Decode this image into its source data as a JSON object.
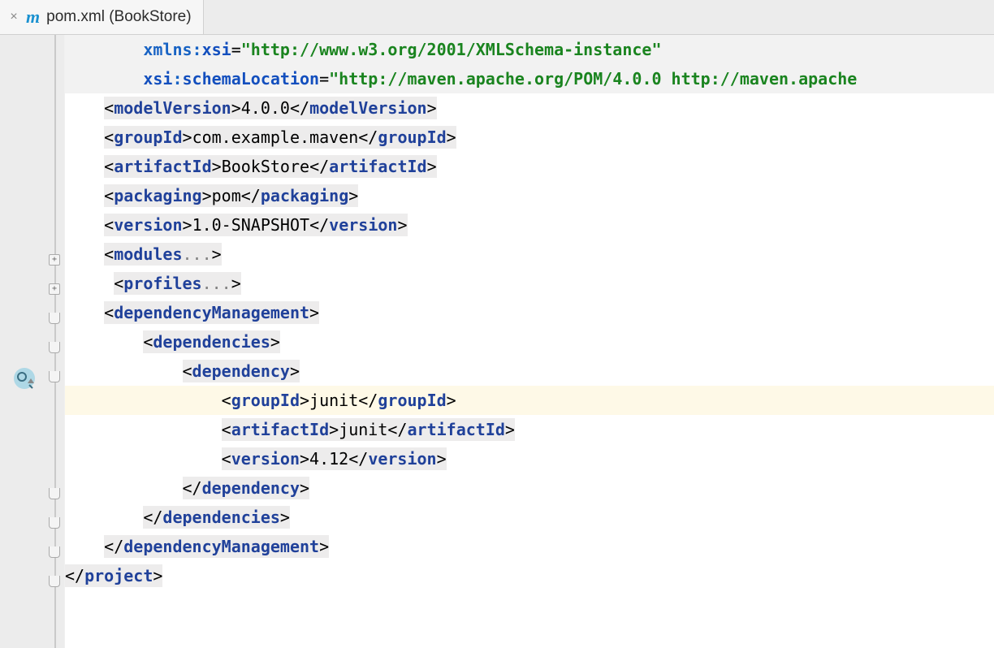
{
  "tab": {
    "close": "×",
    "icon": "m",
    "label": "pom.xml (BookStore)"
  },
  "code": {
    "l0": {
      "pre": "        ",
      "a1p": "xmlns:",
      "a1s": "xsi",
      "eq": "=",
      "v1": "\"http://www.w3.org/2001/XMLSchema-instance\""
    },
    "l1": {
      "pre": "        ",
      "a1p": "xsi",
      "colon": ":",
      "a1s": "schemaLocation",
      "eq": "=",
      "v1": "\"http://maven.apache.org/POM/4.0.0 http://maven.apache"
    },
    "l2": {
      "pre": "    ",
      "o": "<",
      "t": "modelVersion",
      "c": ">",
      "x": "4.0.0",
      "o2": "</",
      "t2": "modelVersion",
      "c2": ">"
    },
    "l3": {
      "pre": "    ",
      "o": "<",
      "t": "groupId",
      "c": ">",
      "x": "com.example.maven",
      "o2": "</",
      "t2": "groupId",
      "c2": ">"
    },
    "l4": {
      "pre": "    ",
      "o": "<",
      "t": "artifactId",
      "c": ">",
      "x": "BookStore",
      "o2": "</",
      "t2": "artifactId",
      "c2": ">"
    },
    "l5": {
      "pre": "    ",
      "o": "<",
      "t": "packaging",
      "c": ">",
      "x": "pom",
      "o2": "</",
      "t2": "packaging",
      "c2": ">"
    },
    "l6": {
      "pre": "    ",
      "o": "<",
      "t": "version",
      "c": ">",
      "x": "1.0-SNAPSHOT",
      "o2": "</",
      "t2": "version",
      "c2": ">"
    },
    "l7": {
      "pre": "    ",
      "o": "<",
      "t": "modules",
      "e": "...",
      "c": ">"
    },
    "l8": {
      "pre": "     ",
      "o": "<",
      "t": "profiles",
      "e": "...",
      "c": ">"
    },
    "l9": {
      "pre": "    ",
      "o": "<",
      "t": "dependencyManagement",
      "c": ">"
    },
    "l10": {
      "pre": "        ",
      "o": "<",
      "t": "dependencies",
      "c": ">"
    },
    "l11": {
      "pre": "            ",
      "o": "<",
      "t": "dependency",
      "c": ">"
    },
    "l12": {
      "pre": "                ",
      "o": "<",
      "t": "groupId",
      "c": ">",
      "x": "junit",
      "o2": "</",
      "t2": "groupId",
      "c2": ">"
    },
    "l13": {
      "pre": "                ",
      "o": "<",
      "t": "artifactId",
      "c": ">",
      "x": "junit",
      "o2": "</",
      "t2": "artifactId",
      "c2": ">"
    },
    "l14": {
      "pre": "                ",
      "o": "<",
      "t": "version",
      "c": ">",
      "x": "4.12",
      "o2": "</",
      "t2": "version",
      "c2": ">"
    },
    "l15": {
      "pre": "            ",
      "o": "</",
      "t": "dependency",
      "c": ">"
    },
    "l16": {
      "pre": "        ",
      "o": "</",
      "t": "dependencies",
      "c": ">"
    },
    "l17": {
      "pre": "    ",
      "o": "</",
      "t": "dependencyManagement",
      "c": ">"
    },
    "l18": {
      "pre": "",
      "o": "</",
      "t": "project",
      "c": ">"
    }
  }
}
